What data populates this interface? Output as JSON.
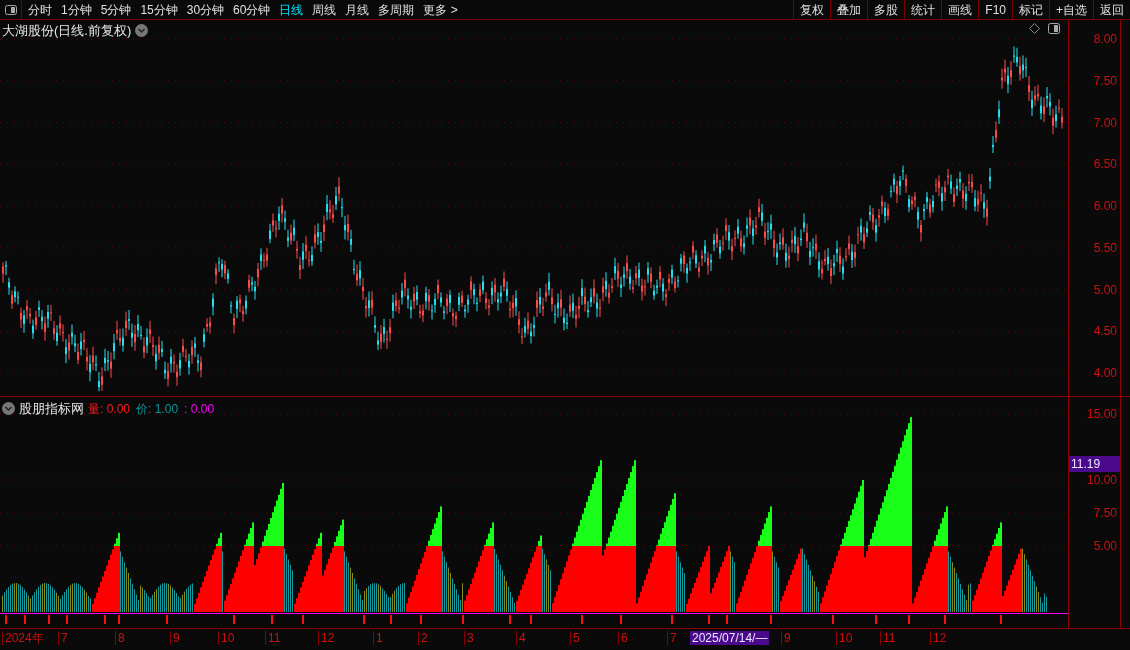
{
  "toolbar": {
    "periods": [
      {
        "label": "分时",
        "selected": false
      },
      {
        "label": "1分钟",
        "selected": false
      },
      {
        "label": "5分钟",
        "selected": false
      },
      {
        "label": "15分钟",
        "selected": false
      },
      {
        "label": "30分钟",
        "selected": false
      },
      {
        "label": "60分钟",
        "selected": false
      },
      {
        "label": "日线",
        "selected": true
      },
      {
        "label": "周线",
        "selected": false
      },
      {
        "label": "月线",
        "selected": false
      },
      {
        "label": "多周期",
        "selected": false
      },
      {
        "label": "更多 >",
        "selected": false
      }
    ],
    "actions": [
      "复权",
      "叠加",
      "多股",
      "统计",
      "画线",
      "F10",
      "标记",
      "+自选",
      "返回"
    ]
  },
  "main_chart": {
    "title": "大湖股份(日线.前复权)",
    "price_ticks": [
      "8.00",
      "7.50",
      "7.00",
      "6.50",
      "6.00",
      "5.50",
      "5.00",
      "4.50",
      "4.00"
    ]
  },
  "indicator": {
    "name": "股朋指标网",
    "fields": [
      {
        "text": "量: 0.00",
        "kind": "volume"
      },
      {
        "text": "价: 1.00",
        "kind": "price"
      },
      {
        "text": ": 0.00",
        "kind": "extra"
      }
    ],
    "ticks": [
      "15.00",
      "10.00",
      "7.50",
      "5.00"
    ],
    "current_value": "11.19"
  },
  "time_axis": {
    "labels": [
      "2024年",
      "7",
      "8",
      "9",
      "10",
      "11",
      "12",
      "1",
      "2",
      "3",
      "4",
      "5",
      "6",
      "7"
    ],
    "cursor_date": "2025/07/14/—",
    "labels_after": [
      "9",
      "10",
      "11",
      "12"
    ]
  }
}
